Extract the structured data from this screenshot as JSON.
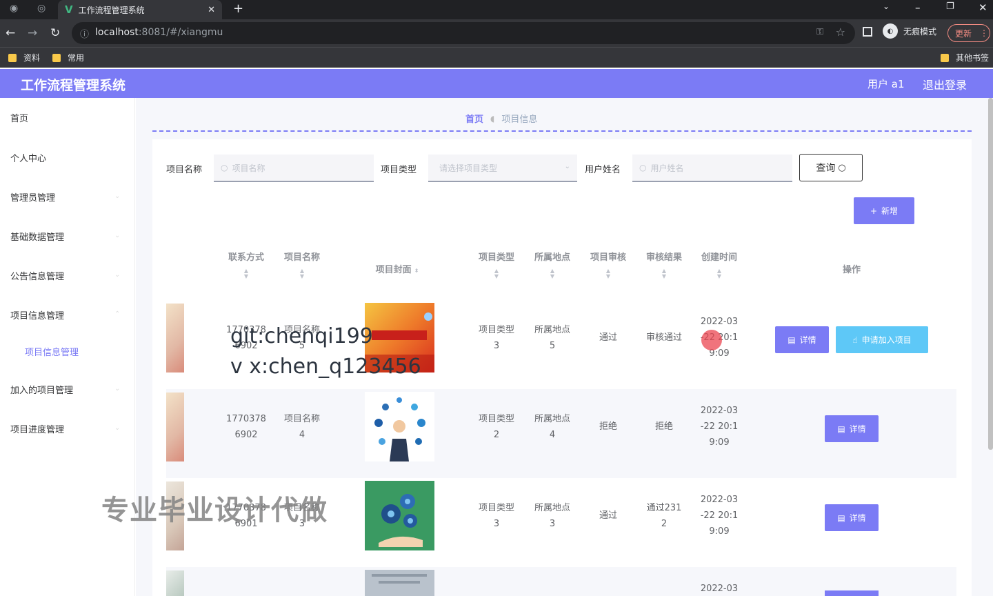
{
  "browser": {
    "tab_title": "工作流程管理系统",
    "url_host": "localhost",
    "url_rest": ":8081/#/xiangmu",
    "incognito_label": "无痕模式",
    "update_label": "更新",
    "bookmarks": [
      "资料",
      "常用"
    ],
    "other_bookmarks": "其他书签"
  },
  "header": {
    "title": "工作流程管理系统",
    "user": "用户 a1",
    "logout": "退出登录"
  },
  "sidebar": {
    "items": [
      "首页",
      "个人中心",
      "管理员管理",
      "基础数据管理",
      "公告信息管理",
      "项目信息管理",
      "项目信息管理",
      "加入的项目管理",
      "项目进度管理"
    ]
  },
  "breadcrumb": {
    "home": "首页",
    "current": "项目信息"
  },
  "search": {
    "label_name": "项目名称",
    "placeholder_name": "项目名称",
    "label_type": "项目类型",
    "placeholder_type": "请选择项目类型",
    "label_user": "用户姓名",
    "placeholder_user": "用户姓名",
    "query": "查询",
    "add": "新增"
  },
  "table": {
    "columns": [
      "联系方式",
      "项目名称",
      "项目封面",
      "项目类型",
      "所属地点",
      "项目审核",
      "审核结果",
      "创建时间",
      "操作"
    ],
    "rows": [
      {
        "phone_a": "1770378",
        "phone_b": "6902",
        "name_a": "项目名称",
        "name_b": "5",
        "type_a": "项目类型",
        "type_b": "3",
        "place_a": "所属地点",
        "place_b": "5",
        "review": "通过",
        "result": "审核通过",
        "time_a": "2022-03",
        "time_b": "-22 20:1",
        "time_c": "9:09"
      },
      {
        "phone_a": "1770378",
        "phone_b": "6902",
        "name_a": "项目名称",
        "name_b": "4",
        "type_a": "项目类型",
        "type_b": "2",
        "place_a": "所属地点",
        "place_b": "4",
        "review": "拒绝",
        "result": "拒绝",
        "time_a": "2022-03",
        "time_b": "-22 20:1",
        "time_c": "9:09"
      },
      {
        "phone_a": "1770378",
        "phone_b": "6901",
        "name_a": "项目名称",
        "name_b": "3",
        "type_a": "项目类型",
        "type_b": "3",
        "place_a": "所属地点",
        "place_b": "3",
        "review": "通过",
        "result_a": "通过231",
        "result_b": "2",
        "time_a": "2022-03",
        "time_b": "-22 20:1",
        "time_c": "9:09"
      },
      {
        "time_a": "2022-03"
      }
    ],
    "detail": "详情",
    "apply": "申请加入项目"
  },
  "watermark": {
    "line1": "git:chenqi199",
    "line2": "v x:chen_q123456",
    "line3": "专业毕业设计代做"
  },
  "colors": {
    "primary": "#7b7bf5",
    "apply": "#5ec8f7",
    "header_bg": "#7b7bf5"
  }
}
